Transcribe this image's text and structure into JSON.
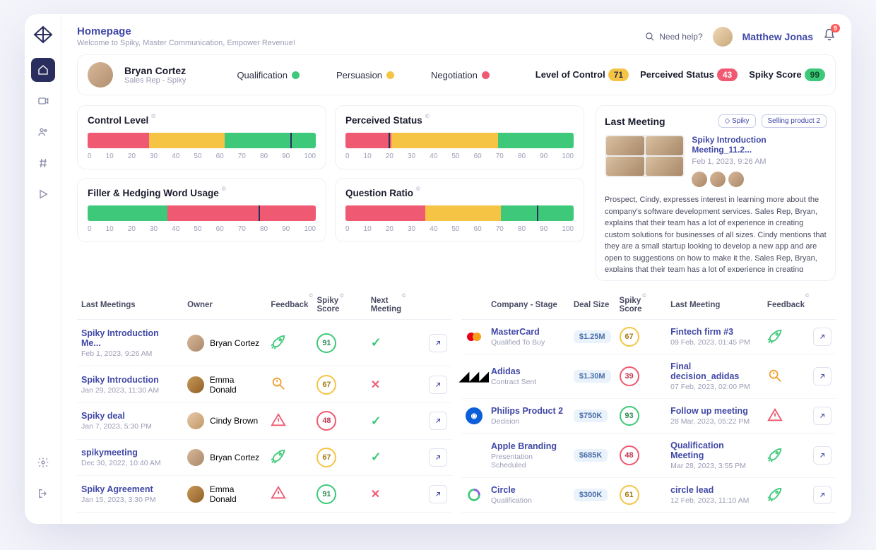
{
  "header": {
    "title": "Homepage",
    "subtitle": "Welcome to Spiky, Master Communication, Empower Revenue!",
    "help": "Need help?",
    "user": "Matthew Jonas",
    "notifications": "9"
  },
  "profile": {
    "name": "Bryan Cortez",
    "role": "Sales Rep - Spiky",
    "tags": {
      "qualification": "Qualification",
      "persuasion": "Persuasion",
      "negotiation": "Negotiation"
    },
    "stats": {
      "loc_label": "Level of Control",
      "loc_val": "71",
      "ps_label": "Perceived Status",
      "ps_val": "43",
      "ss_label": "Spiky Score",
      "ss_val": "99"
    }
  },
  "charts": {
    "control": {
      "title": "Control Level",
      "r": 27,
      "y": 33,
      "g": 40,
      "marker": 89
    },
    "perceived": {
      "title": "Perceived Status",
      "r": 20,
      "y": 47,
      "g": 33,
      "marker": 19
    },
    "filler": {
      "title": "Filler & Hedging Word Usage",
      "g": 35,
      "r": 65,
      "marker": 75
    },
    "question": {
      "title": "Question Ratio",
      "r": 35,
      "y": 33,
      "g": 32,
      "marker": 84
    },
    "axis": [
      "0",
      "10",
      "20",
      "30",
      "40",
      "50",
      "60",
      "70",
      "80",
      "90",
      "100"
    ]
  },
  "last_meeting": {
    "section": "Last Meeting",
    "chip1": "Spiky",
    "chip2": "Selling product 2",
    "title": "Spiky Introduction Meeting_11.2...",
    "date": "Feb 1, 2023, 9:26 AM",
    "desc": "Prospect, Cindy, expresses interest in learning more about the company's software development services. Sales Rep, Bryan, explains that their team has a lot of experience in creating custom solutions for businesses of all sizes. Cindy mentions that they are a small startup looking to develop a new app and are open to suggestions on how to make it the. Sales Rep, Bryan, explains that their team has a lot of experience in creating custom solutions for businesses of all sizes. Cindy mentions that they are a small"
  },
  "meetings": {
    "cols": {
      "last": "Last Meetings",
      "owner": "Owner",
      "feedback": "Feedback",
      "score": "Spiky Score",
      "next": "Next Meeting"
    },
    "rows": [
      {
        "name": "Spiky Introduction Me...",
        "date": "Feb 1, 2023, 9:26 AM",
        "owner": "Bryan Cortez",
        "av": "a1",
        "fb": "rocket-g",
        "score": "91",
        "sc": "g",
        "next": "check"
      },
      {
        "name": "Spiky Introduction",
        "date": "Jan 29, 2023, 11:30 AM",
        "owner": "Emma Donald",
        "av": "a2",
        "fb": "search-y",
        "score": "67",
        "sc": "y",
        "next": "x"
      },
      {
        "name": "Spiky deal",
        "date": "Jan 7, 2023, 5:30 PM",
        "owner": "Cindy Brown",
        "av": "a3",
        "fb": "warn-r",
        "score": "48",
        "sc": "r",
        "next": "check"
      },
      {
        "name": "spikymeeting",
        "date": "Dec 30, 2022, 10:40 AM",
        "owner": "Bryan Cortez",
        "av": "a1",
        "fb": "rocket-g",
        "score": "67",
        "sc": "y",
        "next": "check"
      },
      {
        "name": "Spiky Agreement",
        "date": "Jan 15, 2023, 3:30 PM",
        "owner": "Emma Donald",
        "av": "a2",
        "fb": "warn-r",
        "score": "91",
        "sc": "g",
        "next": "x"
      }
    ]
  },
  "companies": {
    "cols": {
      "company": "Company - Stage",
      "deal": "Deal Size",
      "score": "Spiky Score",
      "last": "Last Meeting",
      "feedback": "Feedback"
    },
    "rows": [
      {
        "logo": "mastercard",
        "name": "MasterCard",
        "stage": "Qualified To Buy",
        "deal": "$1.25M",
        "score": "67",
        "sc": "y",
        "mtg": "Fintech firm #3",
        "mdate": "09 Feb, 2023, 01:45 PM",
        "fb": "rocket-g"
      },
      {
        "logo": "adidas",
        "name": "Adidas",
        "stage": "Contract Sent",
        "deal": "$1.30M",
        "score": "39",
        "sc": "r",
        "mtg": "Final decision_adidas",
        "mdate": "07 Feb, 2023, 02:00 PM",
        "fb": "search-y"
      },
      {
        "logo": "philips",
        "name": "Philips Product 2",
        "stage": "Decision",
        "deal": "$750K",
        "score": "93",
        "sc": "g",
        "mtg": "Follow up meeting",
        "mdate": "28 Mar, 2023, 05:22 PM",
        "fb": "warn-r"
      },
      {
        "logo": "apple",
        "name": "Apple Branding",
        "stage": "Presentation Scheduled",
        "deal": "$685K",
        "score": "48",
        "sc": "r",
        "mtg": "Qualification Meeting",
        "mdate": "Mar 28, 2023, 3:55 PM",
        "fb": "rocket-g"
      },
      {
        "logo": "circle",
        "name": "Circle",
        "stage": "Qualification",
        "deal": "$300K",
        "score": "61",
        "sc": "y",
        "mtg": "circle lead",
        "mdate": "12 Feb, 2023, 11:10 AM",
        "fb": "rocket-g"
      }
    ]
  }
}
